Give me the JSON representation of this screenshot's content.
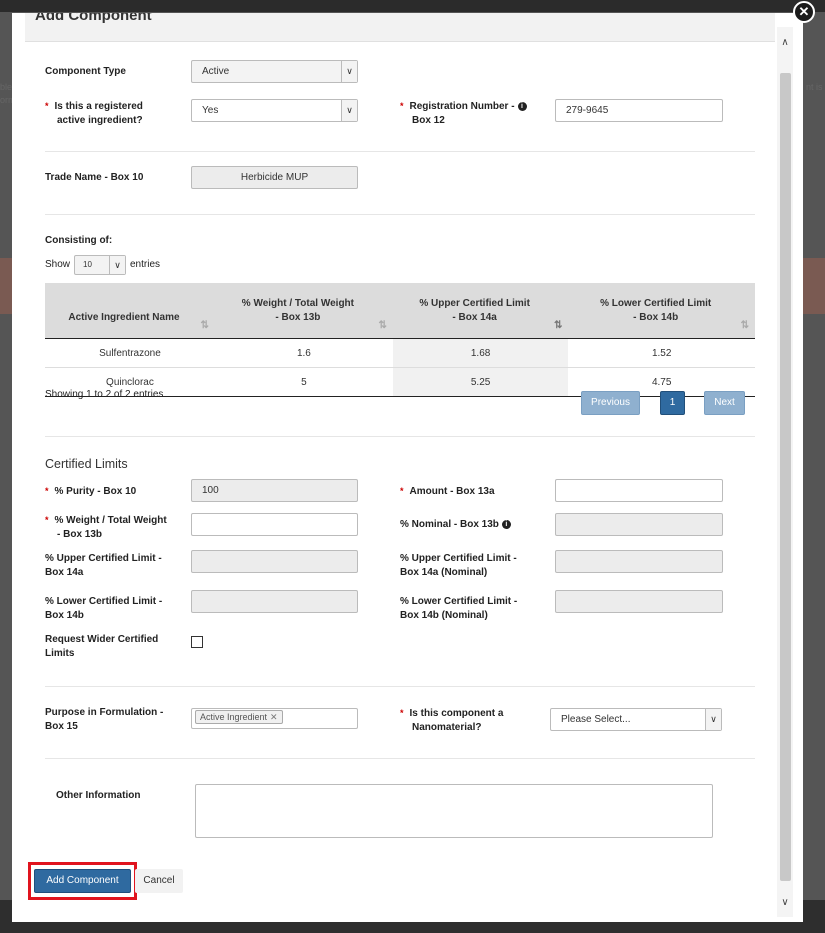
{
  "background": {
    "left_text_1": "ble",
    "left_text_2": "orm",
    "right_text": "nt is"
  },
  "modal": {
    "title": "Add Component",
    "close_glyph": "✕"
  },
  "component_type": {
    "label": "Component Type",
    "value": "Active"
  },
  "registered": {
    "label_line1": "Is this a registered",
    "label_line2": "active ingredient?",
    "value": "Yes"
  },
  "registration_number": {
    "label_line1": "Registration Number -",
    "label_line2": "Box 12",
    "value": "279-9645"
  },
  "trade_name": {
    "label": "Trade Name - Box 10",
    "value": "Herbicide MUP"
  },
  "consisting": {
    "label": "Consisting of:",
    "show_label": "Show",
    "page_size": "10",
    "entries_label": "entries",
    "columns": [
      {
        "line1": "Active Ingredient Name",
        "line2": ""
      },
      {
        "line1": "% Weight / Total Weight",
        "line2": "- Box 13b"
      },
      {
        "line1": "% Upper Certified Limit",
        "line2": "- Box 14a"
      },
      {
        "line1": "% Lower Certified Limit",
        "line2": "- Box 14b"
      }
    ],
    "rows": [
      [
        "Sulfentrazone",
        "1.6",
        "1.68",
        "1.52"
      ],
      [
        "Quinclorac",
        "5",
        "5.25",
        "4.75"
      ]
    ],
    "info": "Showing 1 to 2 of 2 entries",
    "previous": "Previous",
    "page": "1",
    "next": "Next"
  },
  "certified": {
    "title": "Certified Limits",
    "purity": {
      "label": "% Purity - Box 10",
      "value": "100"
    },
    "amount": {
      "label": "Amount - Box 13a",
      "value": ""
    },
    "weight": {
      "label_line1": "% Weight / Total Weight",
      "label_line2": "- Box 13b",
      "value": ""
    },
    "nominal": {
      "label": "% Nominal - Box 13b",
      "value": ""
    },
    "upper": {
      "label_line1": "% Upper Certified Limit -",
      "label_line2": "Box 14a",
      "value": ""
    },
    "upper_nominal": {
      "label_line1": "% Upper Certified Limit -",
      "label_line2": "Box 14a (Nominal)",
      "value": ""
    },
    "lower": {
      "label_line1": "% Lower Certified Limit -",
      "label_line2": "Box 14b",
      "value": ""
    },
    "lower_nominal": {
      "label_line1": "% Lower Certified Limit -",
      "label_line2": "Box 14b (Nominal)",
      "value": ""
    },
    "wider": {
      "label_line1": "Request Wider Certified",
      "label_line2": "Limits",
      "checked": false
    }
  },
  "purpose": {
    "label_line1": "Purpose in Formulation -",
    "label_line2": "Box 15",
    "tag": "Active Ingredient",
    "tag_remove": "✕"
  },
  "nanomaterial": {
    "label_line1": "Is this component a",
    "label_line2": "Nanomaterial?",
    "value": "Please Select..."
  },
  "other": {
    "label": "Other Information",
    "value": ""
  },
  "footer": {
    "add_label": "Add Component",
    "cancel_label": "Cancel"
  },
  "required_marker": "*",
  "info_glyph": "i",
  "colors": {
    "primary": "#2f6aa0",
    "required": "#cc0000",
    "highlight": "#e0141e"
  }
}
